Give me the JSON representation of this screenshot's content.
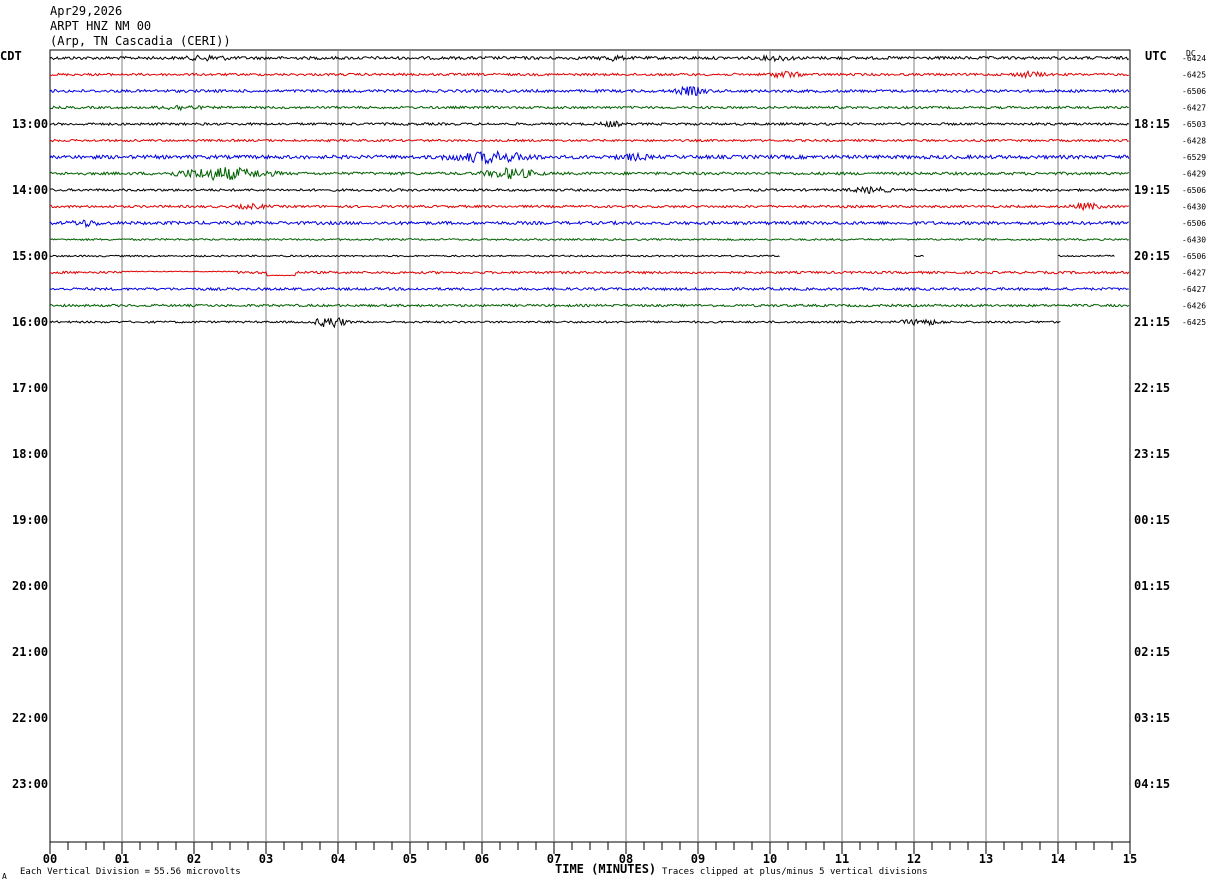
{
  "header": {
    "date": "Apr29,2026",
    "station": "ARPT HNZ NM 00",
    "location": "(Arp, TN Cascadia (CERI))"
  },
  "labels": {
    "left_tz": "CDT",
    "right_tz": "UTC",
    "dc": "DC"
  },
  "footer": {
    "division_label": "Each Vertical Division =",
    "division_value": "55.56 microvolts",
    "axis_title": "TIME (MINUTES)",
    "clip_note": "Traces clipped at plus/minus 5 vertical divisions",
    "corner_mark": "A"
  },
  "colors": {
    "trace_cycle": [
      "#000000",
      "#e00000",
      "#0000e0",
      "#006000"
    ],
    "grid": "#808080"
  },
  "chart_data": {
    "type": "line",
    "x_minutes": {
      "min": 0,
      "max": 15,
      "major_step": 1,
      "minor_step": 0.25
    },
    "x_tick_labels": [
      "00",
      "01",
      "02",
      "03",
      "04",
      "05",
      "06",
      "07",
      "08",
      "09",
      "10",
      "11",
      "12",
      "13",
      "14",
      "15"
    ],
    "left_hour_labels": [
      "13:00",
      "14:00",
      "15:00",
      "16:00",
      "17:00",
      "18:00",
      "19:00",
      "20:00",
      "21:00",
      "22:00",
      "23:00"
    ],
    "right_hour_labels": [
      "18:15",
      "19:15",
      "20:15",
      "21:15",
      "22:15",
      "23:15",
      "00:15",
      "01:15",
      "02:15",
      "03:15",
      "04:15"
    ],
    "traces_per_hour": 4,
    "series": [
      {
        "dc": "-6424",
        "amp": 1.5,
        "bursts": [
          [
            2.2,
            0.4,
            2
          ],
          [
            7.8,
            0.2,
            2.5
          ],
          [
            10.1,
            0.3,
            2
          ]
        ]
      },
      {
        "dc": "-6425",
        "amp": 1.2,
        "bursts": [
          [
            10.2,
            0.3,
            3
          ],
          [
            13.6,
            0.3,
            2.5
          ]
        ]
      },
      {
        "dc": "-6506",
        "amp": 1.4,
        "bursts": [
          [
            8.9,
            0.3,
            4
          ]
        ]
      },
      {
        "dc": "-6427",
        "amp": 1.2,
        "bursts": [
          [
            1.8,
            0.4,
            2
          ]
        ]
      },
      {
        "dc": "-6503",
        "amp": 1.2,
        "bursts": [
          [
            7.8,
            0.2,
            2.5
          ]
        ]
      },
      {
        "dc": "-6428",
        "amp": 1.1,
        "bursts": []
      },
      {
        "dc": "-6529",
        "amp": 1.8,
        "bursts": [
          [
            6.1,
            0.8,
            5
          ],
          [
            8.1,
            0.3,
            2.5
          ]
        ]
      },
      {
        "dc": "-6429",
        "amp": 1.4,
        "bursts": [
          [
            2.4,
            0.9,
            6
          ],
          [
            6.4,
            0.5,
            5
          ]
        ]
      },
      {
        "dc": "-6506",
        "amp": 1.2,
        "bursts": [
          [
            11.4,
            0.4,
            2.5
          ]
        ]
      },
      {
        "dc": "-6430",
        "amp": 1.2,
        "bursts": [
          [
            2.8,
            0.3,
            2
          ],
          [
            14.4,
            0.3,
            3
          ]
        ]
      },
      {
        "dc": "-6506",
        "amp": 1.6,
        "bursts": [
          [
            0.5,
            0.3,
            2.5
          ]
        ]
      },
      {
        "dc": "-6430",
        "amp": 0.9,
        "bursts": []
      },
      {
        "dc": "-6506",
        "amp": 0.8,
        "bursts": [],
        "segments": [
          [
            0,
            10.15
          ],
          [
            12.0,
            12.15
          ],
          [
            14.0,
            14.8
          ]
        ]
      },
      {
        "dc": "-6427",
        "amp": 1.2,
        "bursts": [],
        "steps": [
          [
            1.0,
            2.6,
            -1
          ],
          [
            3.0,
            3.4,
            3
          ]
        ]
      },
      {
        "dc": "-6427",
        "amp": 1.3,
        "bursts": []
      },
      {
        "dc": "-6426",
        "amp": 1.2,
        "bursts": []
      },
      {
        "dc": "-6425",
        "amp": 1.0,
        "bursts": [
          [
            3.9,
            0.3,
            6
          ],
          [
            12.1,
            0.4,
            3
          ]
        ],
        "segments": [
          [
            0,
            14.05
          ]
        ]
      }
    ]
  }
}
